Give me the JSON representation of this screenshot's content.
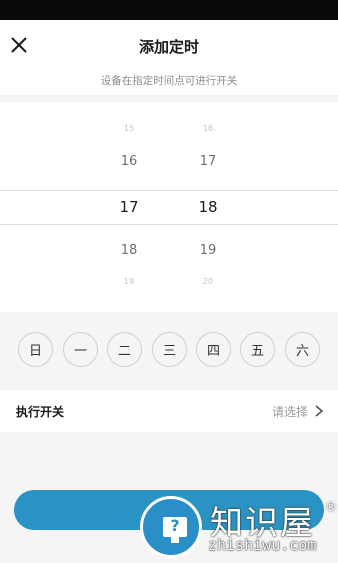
{
  "header": {
    "title": "添加定时",
    "subtitle": "设备在指定时间点可进行开关"
  },
  "picker": {
    "hours": [
      "15",
      "16",
      "17",
      "18",
      "19"
    ],
    "minutes": [
      "16",
      "17",
      "18",
      "19",
      "20"
    ],
    "selected_hour": "17",
    "selected_minute": "18"
  },
  "days": [
    "日",
    "一",
    "二",
    "三",
    "四",
    "五",
    "六"
  ],
  "action_row": {
    "label": "执行开关",
    "value": "请选择"
  },
  "watermark": {
    "text": "知识屋",
    "registered": "®",
    "url": "zhishiwu.com",
    "badge_glyph": "?"
  },
  "colors": {
    "accent": "#2b93c4",
    "status_bar": "#0a0a0a",
    "background": "#f5f5f5"
  }
}
